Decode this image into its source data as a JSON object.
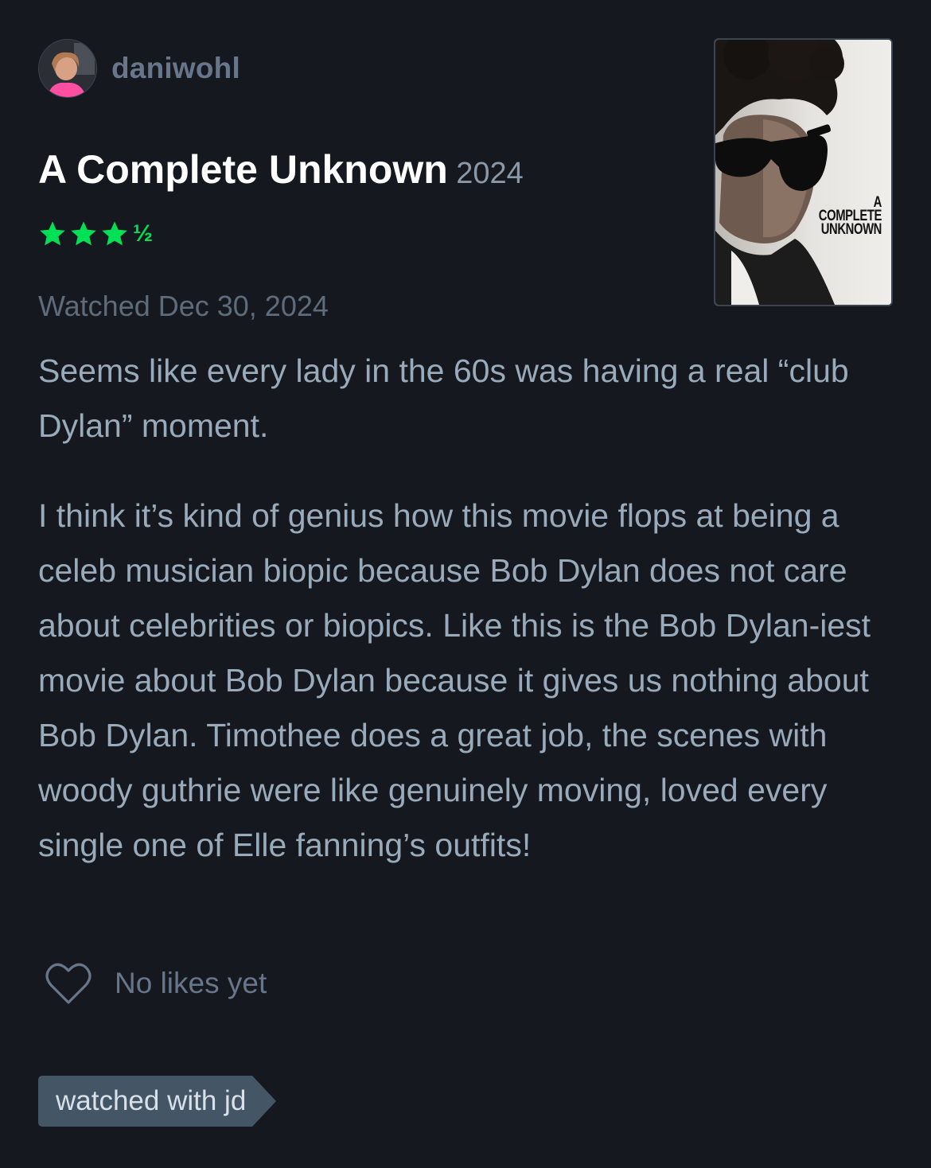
{
  "author": {
    "username": "daniwohl",
    "avatar_icon": "user-avatar"
  },
  "film": {
    "title": "A Complete Unknown",
    "year": "2024",
    "poster_text": [
      "A",
      "COMPLETE",
      "UNKNOWN"
    ]
  },
  "rating": {
    "stars": 3.5,
    "full_stars": 3,
    "half_glyph": "½",
    "color": "#00e054"
  },
  "watched": {
    "label": "Watched Dec 30, 2024"
  },
  "review": {
    "paragraphs": [
      "Seems like every lady in the 60s was having a real “club Dylan” moment.",
      "I think it’s kind of genius how this movie flops at being a celeb musician biopic because Bob Dylan does not care about celebrities or biopics. Like this is the Bob Dylan-iest movie about Bob Dylan because it gives us nothing about Bob Dylan. Timothee does a great job, the scenes with woody guthrie were like genuinely moving, loved every single one of Elle fanning’s outfits!"
    ]
  },
  "likes": {
    "icon": "heart-icon",
    "label": "No likes yet"
  },
  "tags": [
    {
      "label": "watched with jd"
    }
  ],
  "colors": {
    "background": "#15181e",
    "title": "#ffffff",
    "body_text": "#99aabb",
    "muted": "#67768a",
    "tag_bg": "#445566"
  }
}
